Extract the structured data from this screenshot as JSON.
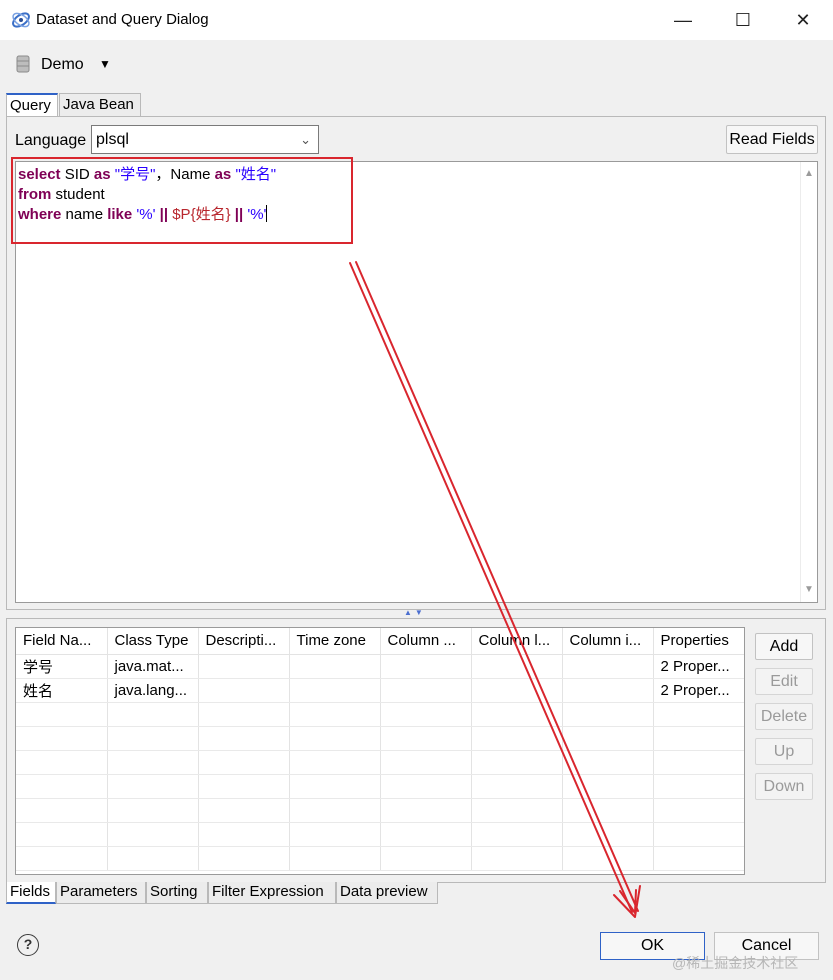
{
  "window": {
    "title": "Dataset and Query Dialog",
    "minimize": "—",
    "maximize": "☐",
    "close": "✕"
  },
  "datasource": {
    "name": "Demo",
    "caret": "▼"
  },
  "top_tabs": [
    "Query",
    "Java Bean"
  ],
  "query": {
    "language_label": "Language",
    "language_value": "plsql",
    "read_fields_label": "Read Fields",
    "sql_tokens": {
      "select": "select",
      "sid": " SID ",
      "as": "as",
      "sid_alias": " \"学号\"",
      "name": "，Name ",
      "name_alias": " \"姓名\"",
      "from": "from",
      "student": " student",
      "where": "where",
      "name2": " name ",
      "like": "like",
      "pct1": " '%'",
      "or1": " || ",
      "param": "$P{姓名}",
      "or2": " || ",
      "pct2": "'%'"
    }
  },
  "fields_table": {
    "columns": [
      "Field Na...",
      "Class Type",
      "Descripti...",
      "Time zone",
      "Column ...",
      "Column l...",
      "Column i...",
      "Properties"
    ],
    "rows": [
      [
        "学号",
        "java.mat...",
        "",
        "",
        "",
        "",
        "",
        "2 Proper..."
      ],
      [
        "姓名",
        "java.lang...",
        "",
        "",
        "",
        "",
        "",
        "2 Proper..."
      ]
    ]
  },
  "side_buttons": {
    "add": "Add",
    "edit": "Edit",
    "delete": "Delete",
    "up": "Up",
    "down": "Down"
  },
  "bottom_tabs": [
    "Fields",
    "Parameters",
    "Sorting",
    "Filter Expression",
    "Data preview"
  ],
  "footer": {
    "help": "?",
    "ok": "OK",
    "cancel": "Cancel"
  },
  "watermark": "@稀土掘金技术社区",
  "colors": {
    "keyword": "#7f0055",
    "string": "#2a00ff",
    "parameter": "#b8262d",
    "annotation": "#d9262e",
    "accent": "#2f62c7"
  }
}
